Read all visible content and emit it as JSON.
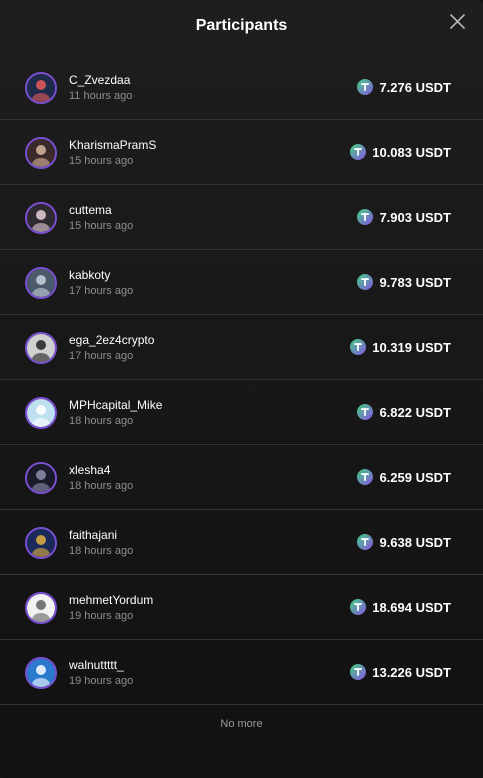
{
  "modal": {
    "title": "Participants",
    "close_icon": "close-icon"
  },
  "participants": [
    {
      "name": "C_Zvezdaa",
      "time": "11 hours ago",
      "amount": "7.276 USDT",
      "avatar_color": "#1e2a4a",
      "avatar_accent": "#e85a5a"
    },
    {
      "name": "KharismaPramS",
      "time": "15 hours ago",
      "amount": "10.083 USDT",
      "avatar_color": "#3a2a2a",
      "avatar_accent": "#d8b8a0"
    },
    {
      "name": "cuttema",
      "time": "15 hours ago",
      "amount": "7.903 USDT",
      "avatar_color": "#2e2a30",
      "avatar_accent": "#e8d0d8"
    },
    {
      "name": "kabkoty",
      "time": "17 hours ago",
      "amount": "9.783 USDT",
      "avatar_color": "#4a5a6a",
      "avatar_accent": "#c8d0d8"
    },
    {
      "name": "ega_2ez4crypto",
      "time": "17 hours ago",
      "amount": "10.319 USDT",
      "avatar_color": "#d0d0d0",
      "avatar_accent": "#202020"
    },
    {
      "name": "MPHcapital_Mike",
      "time": "18 hours ago",
      "amount": "6.822 USDT",
      "avatar_color": "#bfe0f0",
      "avatar_accent": "#ffffff"
    },
    {
      "name": "xlesha4",
      "time": "18 hours ago",
      "amount": "6.259 USDT",
      "avatar_color": "#1a1a2a",
      "avatar_accent": "#9090b0"
    },
    {
      "name": "faithajani",
      "time": "18 hours ago",
      "amount": "9.638 USDT",
      "avatar_color": "#1a2a5a",
      "avatar_accent": "#e0b040"
    },
    {
      "name": "mehmetYordum",
      "time": "19 hours ago",
      "amount": "18.694 USDT",
      "avatar_color": "#f2f2f2",
      "avatar_accent": "#606060"
    },
    {
      "name": "walnuttttt_",
      "time": "19 hours ago",
      "amount": "13.226 USDT",
      "avatar_color": "#2a7ad0",
      "avatar_accent": "#ffffff"
    }
  ],
  "footer": {
    "text": "No more"
  },
  "colors": {
    "background": "#1a1a1a",
    "divider": "#333333",
    "avatar_border": "#7b4fd3",
    "token_start": "#3fd17f",
    "token_end": "#8a52e6"
  }
}
